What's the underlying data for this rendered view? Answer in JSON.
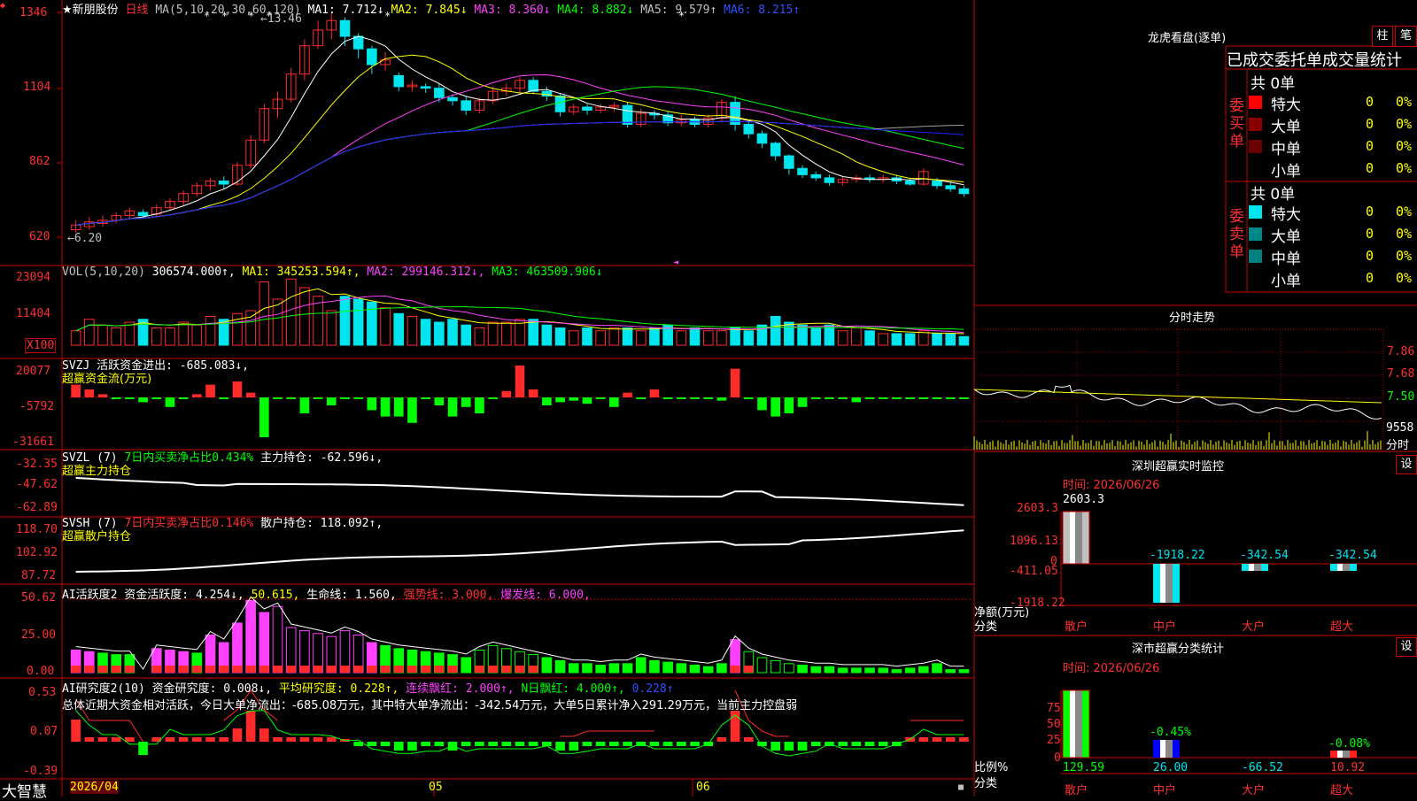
{
  "colors": {
    "up": "#ff2a2a",
    "down": "#00e5ee",
    "frame": "#c80000",
    "text": "#c0c0c0",
    "yellow": "#ffff00",
    "magenta": "#ff40ff",
    "green": "#00ff00",
    "white": "#ffffff",
    "gray": "#a0a0a0",
    "blue": "#2020ff"
  },
  "stock_name": "★新朋股份",
  "period_label": "日线",
  "ma_legend": {
    "label": "MA(5,10,20,30,60,120)",
    "ma1": "MA1: 7.712↓",
    "ma2": "MA2: 7.845↓",
    "ma3": "MA3: 8.360↓",
    "ma4": "MA4: 8.882↓",
    "ma5": "MA5: 9.579↑",
    "ma6": "MA6: 8.215↑"
  },
  "vol_legend": {
    "label": "VOL(5,10,20)",
    "val": "306574.000↑,",
    "ma1": "MA1: 345253.594↑,",
    "ma2": "MA2: 299146.312↓,",
    "ma3": "MA3: 463509.906↓"
  },
  "svzj_legend": {
    "a": "SVZJ  活跃资金进出: -685.083↓,",
    "b": "超赢资金流(万元)"
  },
  "svzl_legend": {
    "a": "SVZL (7) ",
    "b": "7日内买卖净占比0.434% ",
    "c": "主力持仓: -62.596↓,",
    "d": "超赢主力持仓"
  },
  "svsh_legend": {
    "a": "SVSH (7) ",
    "b": "7日内买卖净占比0.146% ",
    "c": "散户持仓: 118.092↑,",
    "d": "超赢散户持仓"
  },
  "ai1_legend": {
    "a": "AI活跃度2 资金活跃度: 4.254↓,",
    "b": "50.615,",
    "c": "生命线: 1.560,",
    "d": "强势线: 3.000,",
    "e": "爆发线: 6.000,"
  },
  "ai2_legend": {
    "a": "AI研究度2(10) 资金研究度: 0.008↓,",
    "b": "平均研究度: 0.228↑,",
    "c": "连续飘红: 2.000↑,",
    "d": "N日飘红: 4.000↑,",
    "e": "0.228↑"
  },
  "summary_text": "总体近期大资金相对活跃，今日大单净流出：-685.08万元，其中特大单净流出：-342.54万元，大单5日累计净入291.29万元，当前主力控盘弱",
  "price_axis": [
    "1346",
    "1104",
    "862",
    "620"
  ],
  "vol_axis": [
    "23094",
    "11404",
    "X100"
  ],
  "svzj_axis": [
    "20077",
    "-5792",
    "-31661"
  ],
  "svzl_axis": [
    "-32.35",
    "-47.62",
    "-62.89"
  ],
  "svsh_axis": [
    "118.70",
    "102.92",
    "87.72"
  ],
  "ai1_axis": [
    "50.62",
    "25.00",
    "0.00"
  ],
  "ai2_axis": [
    "0.53",
    "0.07",
    "-0.39"
  ],
  "price_high_label": "13.46",
  "price_low_label": "6.20",
  "date_axis": [
    "2026/04",
    "05",
    "06"
  ],
  "brand": "大智慧",
  "right": {
    "lhb_title": "龙虎看盘(逐单)",
    "btn_zhu": "柱",
    "btn_bi": "笔",
    "tabs_label": "已成交委托单成交量统计",
    "buy": {
      "side": "委买单",
      "total": "共 0单",
      "rows": [
        {
          "name": "特大",
          "n": "0",
          "p": "0%"
        },
        {
          "name": "大单",
          "n": "0",
          "p": "0%"
        },
        {
          "name": "中单",
          "n": "0",
          "p": "0%"
        },
        {
          "name": "小单",
          "n": "0",
          "p": "0%"
        }
      ]
    },
    "sell": {
      "side": "委卖单",
      "total": "共 0单",
      "rows": [
        {
          "name": "特大",
          "n": "0",
          "p": "0%"
        },
        {
          "name": "大单",
          "n": "0",
          "p": "0%"
        },
        {
          "name": "中单",
          "n": "0",
          "p": "0%"
        },
        {
          "name": "小单",
          "n": "0",
          "p": "0%"
        }
      ]
    },
    "intraday_title": "分时走势",
    "intraday_axis": [
      "7.86",
      "7.68",
      "7.50",
      "9558"
    ],
    "intraday_tag": "分时",
    "sz_monitor": {
      "title": "深圳超赢实时监控",
      "btn": "设",
      "time": "时间: 2026/06/26",
      "top_val": "2603.3",
      "axis": [
        "2603.3",
        "1096.13",
        "0",
        "-411.05",
        "-1918.22"
      ],
      "vals": [
        {
          "v": "-1918.22"
        },
        {
          "v": "-342.54"
        },
        {
          "v": "-342.54"
        }
      ],
      "unit": "净额(万元)",
      "cat_label": "分类",
      "cats": [
        "散户",
        "中户",
        "大户",
        "超大"
      ]
    },
    "sz_class": {
      "title": "深市超赢分类统计",
      "btn": "设",
      "time": "时间: 2026/06/26",
      "axis": [
        "75",
        "50",
        "25",
        "0"
      ],
      "pct_labels": [
        "-0.45%",
        "-0.08%"
      ],
      "unit": "比例%",
      "cat_label": "分类",
      "cats": [
        "散户",
        "中户",
        "大户",
        "超大"
      ],
      "vals": [
        "129.59",
        "26.00",
        "-66.52",
        "10.92"
      ]
    }
  },
  "chart_data": {
    "type": "candlestick",
    "title": "新朋股份 日线",
    "price_ylim": [
      6.2,
      13.46
    ],
    "series_note": "daily OHLC estimated from chart",
    "candles": [
      [
        6.55,
        6.7,
        6.45,
        6.85
      ],
      [
        6.65,
        6.8,
        6.55,
        6.95
      ],
      [
        6.75,
        6.85,
        6.65,
        7.0
      ],
      [
        6.85,
        7.0,
        6.75,
        7.1
      ],
      [
        7.0,
        7.15,
        6.9,
        7.25
      ],
      [
        7.1,
        7.0,
        6.9,
        7.2
      ],
      [
        7.05,
        7.25,
        6.95,
        7.35
      ],
      [
        7.25,
        7.45,
        7.15,
        7.55
      ],
      [
        7.45,
        7.7,
        7.3,
        7.8
      ],
      [
        7.7,
        7.95,
        7.6,
        8.05
      ],
      [
        7.95,
        8.1,
        7.8,
        8.2
      ],
      [
        8.1,
        8.0,
        7.85,
        8.25
      ],
      [
        8.0,
        8.6,
        7.95,
        8.7
      ],
      [
        8.6,
        9.4,
        8.5,
        9.55
      ],
      [
        9.4,
        10.4,
        9.3,
        10.55
      ],
      [
        10.4,
        10.7,
        10.1,
        10.95
      ],
      [
        10.7,
        11.5,
        10.6,
        11.7
      ],
      [
        11.5,
        12.4,
        11.3,
        12.6
      ],
      [
        12.4,
        12.9,
        12.3,
        13.2
      ],
      [
        12.9,
        13.2,
        12.6,
        13.46
      ],
      [
        13.2,
        12.7,
        12.4,
        13.3
      ],
      [
        12.7,
        12.3,
        12.0,
        12.8
      ],
      [
        12.3,
        11.8,
        11.5,
        12.4
      ],
      [
        11.8,
        11.95,
        11.6,
        12.2
      ],
      [
        11.45,
        11.1,
        10.95,
        11.55
      ],
      [
        11.1,
        11.15,
        10.95,
        11.3
      ],
      [
        11.1,
        11.05,
        10.9,
        11.2
      ],
      [
        11.05,
        10.75,
        10.6,
        11.2
      ],
      [
        10.75,
        10.65,
        10.5,
        10.85
      ],
      [
        10.65,
        10.35,
        10.2,
        10.8
      ],
      [
        10.35,
        10.65,
        10.25,
        10.75
      ],
      [
        10.65,
        10.95,
        10.55,
        11.1
      ],
      [
        10.95,
        11.05,
        10.8,
        11.2
      ],
      [
        11.05,
        11.3,
        10.9,
        11.4
      ],
      [
        11.3,
        10.95,
        10.85,
        11.4
      ],
      [
        10.95,
        10.8,
        10.65,
        11.1
      ],
      [
        10.8,
        10.3,
        10.15,
        10.9
      ],
      [
        10.3,
        10.45,
        10.2,
        10.55
      ],
      [
        10.45,
        10.35,
        10.2,
        10.55
      ],
      [
        10.35,
        10.45,
        10.25,
        10.55
      ],
      [
        10.45,
        10.5,
        10.3,
        10.6
      ],
      [
        10.5,
        9.9,
        9.8,
        10.6
      ],
      [
        9.9,
        10.25,
        9.8,
        10.4
      ],
      [
        10.25,
        10.2,
        10.05,
        10.35
      ],
      [
        10.2,
        9.95,
        9.85,
        10.3
      ],
      [
        9.95,
        10.05,
        9.85,
        10.2
      ],
      [
        10.05,
        9.9,
        9.8,
        10.15
      ],
      [
        9.9,
        10.1,
        9.8,
        10.2
      ],
      [
        10.1,
        10.6,
        10.0,
        10.7
      ],
      [
        10.6,
        9.9,
        9.7,
        10.8
      ],
      [
        9.9,
        9.6,
        9.45,
        10.0
      ],
      [
        9.6,
        9.3,
        9.15,
        9.7
      ],
      [
        9.3,
        8.9,
        8.75,
        9.35
      ],
      [
        8.9,
        8.5,
        8.3,
        8.95
      ],
      [
        8.5,
        8.3,
        8.2,
        8.6
      ],
      [
        8.3,
        8.2,
        8.1,
        8.4
      ],
      [
        8.2,
        8.05,
        7.95,
        8.3
      ],
      [
        8.05,
        8.15,
        7.95,
        8.25
      ],
      [
        8.15,
        8.2,
        8.05,
        8.3
      ],
      [
        8.2,
        8.15,
        8.05,
        8.3
      ],
      [
        8.15,
        8.2,
        8.05,
        8.3
      ],
      [
        8.2,
        8.1,
        8.0,
        8.3
      ],
      [
        8.1,
        8.0,
        7.95,
        8.2
      ],
      [
        8.0,
        8.4,
        7.95,
        8.5
      ],
      [
        8.1,
        7.95,
        7.85,
        8.2
      ],
      [
        7.95,
        7.85,
        7.75,
        8.05
      ],
      [
        7.85,
        7.7,
        7.6,
        7.95
      ]
    ],
    "volume": [
      5,
      9,
      7,
      6,
      8,
      9,
      6,
      6,
      8,
      7,
      10,
      9,
      11,
      12,
      22,
      16,
      23,
      20,
      17,
      12,
      17,
      16,
      15,
      13,
      11,
      10,
      9,
      8,
      9,
      7,
      6,
      8,
      8,
      9,
      9,
      7,
      6,
      5,
      6,
      5,
      6,
      6,
      5,
      6,
      7,
      5,
      6,
      5,
      5,
      6,
      5,
      7,
      10,
      8,
      7,
      6,
      7,
      5,
      6,
      5,
      4,
      4,
      4,
      5,
      4,
      4,
      3
    ],
    "svzj": [
      8,
      5,
      2,
      -1,
      0,
      -3,
      0,
      -6,
      0,
      2,
      8,
      0,
      10,
      3,
      -25,
      0,
      0,
      -10,
      0,
      -5,
      0,
      0,
      -8,
      -12,
      -12,
      -16,
      0,
      -5,
      -12,
      -6,
      -10,
      0,
      4,
      20,
      5,
      -5,
      -3,
      -2,
      -4,
      0,
      -6,
      3,
      -1,
      5,
      -1,
      0,
      0,
      0,
      -2,
      18,
      0,
      -8,
      -12,
      -10,
      -6,
      0,
      0,
      0,
      -3,
      0,
      0,
      0,
      0,
      0,
      0,
      0,
      0
    ],
    "ai_activity": [
      15,
      14,
      13,
      12,
      12,
      0,
      16,
      15,
      14,
      13,
      25,
      20,
      33,
      48,
      40,
      44,
      30,
      28,
      26,
      24,
      28,
      25,
      20,
      18,
      16,
      15,
      14,
      13,
      12,
      10,
      15,
      18,
      16,
      14,
      12,
      10,
      8,
      6,
      6,
      5,
      6,
      6,
      10,
      8,
      7,
      6,
      5,
      4,
      6,
      22,
      14,
      10,
      8,
      6,
      5,
      4,
      4,
      3,
      3,
      3,
      3,
      2,
      3,
      4,
      6,
      2,
      2
    ],
    "ai_research": [
      0.25,
      0.05,
      0.05,
      0.05,
      0.05,
      -0.15,
      0.05,
      0.05,
      0.05,
      0.05,
      0.05,
      0.05,
      0.15,
      0.35,
      0.15,
      0.05,
      0.05,
      0.05,
      0.05,
      0.05,
      0.02,
      -0.05,
      -0.05,
      -0.05,
      -0.1,
      -0.1,
      -0.05,
      -0.05,
      -0.1,
      -0.05,
      -0.05,
      -0.05,
      -0.05,
      -0.05,
      -0.05,
      -0.05,
      -0.1,
      -0.1,
      -0.05,
      -0.05,
      -0.05,
      -0.05,
      -0.05,
      -0.05,
      -0.05,
      -0.05,
      -0.05,
      -0.05,
      0.05,
      0.35,
      0.05,
      -0.05,
      -0.1,
      -0.1,
      -0.1,
      -0.05,
      -0.05,
      -0.05,
      -0.05,
      -0.05,
      -0.05,
      -0.05,
      0.05,
      0.05,
      0.05,
      0.05,
      0.05
    ]
  }
}
